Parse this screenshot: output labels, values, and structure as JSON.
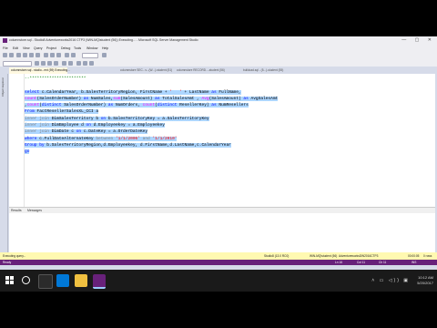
{
  "window": {
    "title": "columnstore.sql - Studio8 Adventureworks2016 CTP3 (WIN-MQ\\student (56)) Executing... - Microsoft SQL Server Management Studio",
    "controls": "— ▢ ✕"
  },
  "menu": [
    "File",
    "Edit",
    "View",
    "Query",
    "Project",
    "Debug",
    "Tools",
    "Window",
    "Help"
  ],
  "tabs": [
    {
      "label": "columnstore.sql - studio...ent (59) Executing...",
      "active": true
    },
    {
      "label": "columnstore SEC...v...(W...)-student (51)",
      "active": false
    },
    {
      "label": "columnstore RECORD...-student (56)",
      "active": false
    },
    {
      "label": "bulkload.sql - (5...)-student (55)",
      "active": false
    }
  ],
  "object_explorer_label": "Object Explorer",
  "editor": {
    "comment_line": "--***********************"
  },
  "results": {
    "tab_results": "Results",
    "tab_messages": "Messages"
  },
  "status": {
    "executing": "Executing query...",
    "server": "Studio8 (13.0 RC0)",
    "user": "WIN-MQ\\student (56)",
    "database": "AdventureworksDW2016CTP3",
    "time": "00:00:05",
    "rows": "0 rows"
  },
  "bottombar": {
    "left": "Ready",
    "ln": "Ln 16",
    "col": "Col 11",
    "ch": "Ch 11",
    "ins": "INS"
  },
  "taskbar": {
    "time": "10:12 AM",
    "date": "5/20/2017",
    "tray": "˄ ▭ ◁)) ▣"
  }
}
